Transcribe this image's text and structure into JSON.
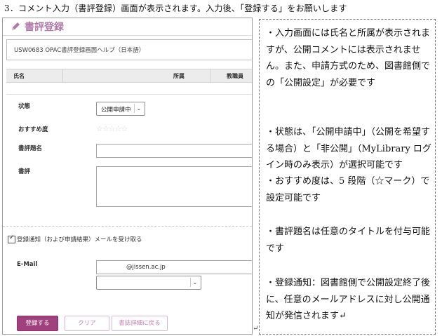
{
  "heading": "3．コメント入力（書評登録）画面が表示されます。入力後、「登録する」をお願いします",
  "screenshot": {
    "title": "書評登録",
    "help_text": "USW0683 OPAC書評登録画面ヘルプ（日本語）",
    "table_headers": {
      "name": "氏名",
      "affiliation": "所属",
      "staff": "教職員"
    },
    "status_label": "状態",
    "status_value": "公開申請中",
    "rating_label": "おすすめ度",
    "rating_stars": "☆☆☆☆☆",
    "review_title_label": "書評題名",
    "review_label": "書評",
    "notify_checked": true,
    "notify_label": "登録通知（および申請結果）メールを受け取る",
    "email_label": "E-Mail",
    "email_value": "@jissen.ac.jp",
    "buttons": {
      "register": "登録する",
      "clear": "クリア",
      "back": "書誌詳細に戻る"
    },
    "return_mark": "↵"
  },
  "notes": [
    "・入力画面には氏名と所属が表示されますが、公開コメントには表示されません。また、申請方式のため、図書館側での「公開設定」が必要です",
    "・状態は、「公開申請中」（公開を希望する場合）と「非公開」（MyLibrary ログイン時のみ表示）が選択可能です",
    "・おすすめ度は、5 段階（☆マーク）で設定可能です",
    "・書評題名は任意のタイトルを付与可能です",
    "・登録通知：図書館側で公開設定終了後に、任意のメールアドレスに対し公開通知が発信されます↵"
  ],
  "colors": {
    "accent": "#a0407c",
    "title": "#b07aa8"
  }
}
